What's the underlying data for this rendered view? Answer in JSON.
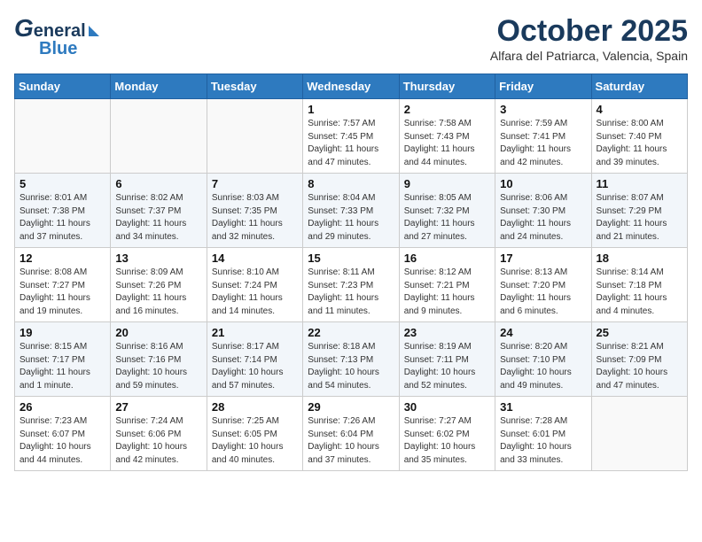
{
  "header": {
    "logo_g": "G",
    "logo_eneral": "eneral",
    "logo_blue": "Blue",
    "month": "October 2025",
    "location": "Alfara del Patriarca, Valencia, Spain"
  },
  "days_of_week": [
    "Sunday",
    "Monday",
    "Tuesday",
    "Wednesday",
    "Thursday",
    "Friday",
    "Saturday"
  ],
  "weeks": [
    [
      {
        "day": "",
        "info": ""
      },
      {
        "day": "",
        "info": ""
      },
      {
        "day": "",
        "info": ""
      },
      {
        "day": "1",
        "info": "Sunrise: 7:57 AM\nSunset: 7:45 PM\nDaylight: 11 hours\nand 47 minutes."
      },
      {
        "day": "2",
        "info": "Sunrise: 7:58 AM\nSunset: 7:43 PM\nDaylight: 11 hours\nand 44 minutes."
      },
      {
        "day": "3",
        "info": "Sunrise: 7:59 AM\nSunset: 7:41 PM\nDaylight: 11 hours\nand 42 minutes."
      },
      {
        "day": "4",
        "info": "Sunrise: 8:00 AM\nSunset: 7:40 PM\nDaylight: 11 hours\nand 39 minutes."
      }
    ],
    [
      {
        "day": "5",
        "info": "Sunrise: 8:01 AM\nSunset: 7:38 PM\nDaylight: 11 hours\nand 37 minutes."
      },
      {
        "day": "6",
        "info": "Sunrise: 8:02 AM\nSunset: 7:37 PM\nDaylight: 11 hours\nand 34 minutes."
      },
      {
        "day": "7",
        "info": "Sunrise: 8:03 AM\nSunset: 7:35 PM\nDaylight: 11 hours\nand 32 minutes."
      },
      {
        "day": "8",
        "info": "Sunrise: 8:04 AM\nSunset: 7:33 PM\nDaylight: 11 hours\nand 29 minutes."
      },
      {
        "day": "9",
        "info": "Sunrise: 8:05 AM\nSunset: 7:32 PM\nDaylight: 11 hours\nand 27 minutes."
      },
      {
        "day": "10",
        "info": "Sunrise: 8:06 AM\nSunset: 7:30 PM\nDaylight: 11 hours\nand 24 minutes."
      },
      {
        "day": "11",
        "info": "Sunrise: 8:07 AM\nSunset: 7:29 PM\nDaylight: 11 hours\nand 21 minutes."
      }
    ],
    [
      {
        "day": "12",
        "info": "Sunrise: 8:08 AM\nSunset: 7:27 PM\nDaylight: 11 hours\nand 19 minutes."
      },
      {
        "day": "13",
        "info": "Sunrise: 8:09 AM\nSunset: 7:26 PM\nDaylight: 11 hours\nand 16 minutes."
      },
      {
        "day": "14",
        "info": "Sunrise: 8:10 AM\nSunset: 7:24 PM\nDaylight: 11 hours\nand 14 minutes."
      },
      {
        "day": "15",
        "info": "Sunrise: 8:11 AM\nSunset: 7:23 PM\nDaylight: 11 hours\nand 11 minutes."
      },
      {
        "day": "16",
        "info": "Sunrise: 8:12 AM\nSunset: 7:21 PM\nDaylight: 11 hours\nand 9 minutes."
      },
      {
        "day": "17",
        "info": "Sunrise: 8:13 AM\nSunset: 7:20 PM\nDaylight: 11 hours\nand 6 minutes."
      },
      {
        "day": "18",
        "info": "Sunrise: 8:14 AM\nSunset: 7:18 PM\nDaylight: 11 hours\nand 4 minutes."
      }
    ],
    [
      {
        "day": "19",
        "info": "Sunrise: 8:15 AM\nSunset: 7:17 PM\nDaylight: 11 hours\nand 1 minute."
      },
      {
        "day": "20",
        "info": "Sunrise: 8:16 AM\nSunset: 7:16 PM\nDaylight: 10 hours\nand 59 minutes."
      },
      {
        "day": "21",
        "info": "Sunrise: 8:17 AM\nSunset: 7:14 PM\nDaylight: 10 hours\nand 57 minutes."
      },
      {
        "day": "22",
        "info": "Sunrise: 8:18 AM\nSunset: 7:13 PM\nDaylight: 10 hours\nand 54 minutes."
      },
      {
        "day": "23",
        "info": "Sunrise: 8:19 AM\nSunset: 7:11 PM\nDaylight: 10 hours\nand 52 minutes."
      },
      {
        "day": "24",
        "info": "Sunrise: 8:20 AM\nSunset: 7:10 PM\nDaylight: 10 hours\nand 49 minutes."
      },
      {
        "day": "25",
        "info": "Sunrise: 8:21 AM\nSunset: 7:09 PM\nDaylight: 10 hours\nand 47 minutes."
      }
    ],
    [
      {
        "day": "26",
        "info": "Sunrise: 7:23 AM\nSunset: 6:07 PM\nDaylight: 10 hours\nand 44 minutes."
      },
      {
        "day": "27",
        "info": "Sunrise: 7:24 AM\nSunset: 6:06 PM\nDaylight: 10 hours\nand 42 minutes."
      },
      {
        "day": "28",
        "info": "Sunrise: 7:25 AM\nSunset: 6:05 PM\nDaylight: 10 hours\nand 40 minutes."
      },
      {
        "day": "29",
        "info": "Sunrise: 7:26 AM\nSunset: 6:04 PM\nDaylight: 10 hours\nand 37 minutes."
      },
      {
        "day": "30",
        "info": "Sunrise: 7:27 AM\nSunset: 6:02 PM\nDaylight: 10 hours\nand 35 minutes."
      },
      {
        "day": "31",
        "info": "Sunrise: 7:28 AM\nSunset: 6:01 PM\nDaylight: 10 hours\nand 33 minutes."
      },
      {
        "day": "",
        "info": ""
      }
    ]
  ]
}
